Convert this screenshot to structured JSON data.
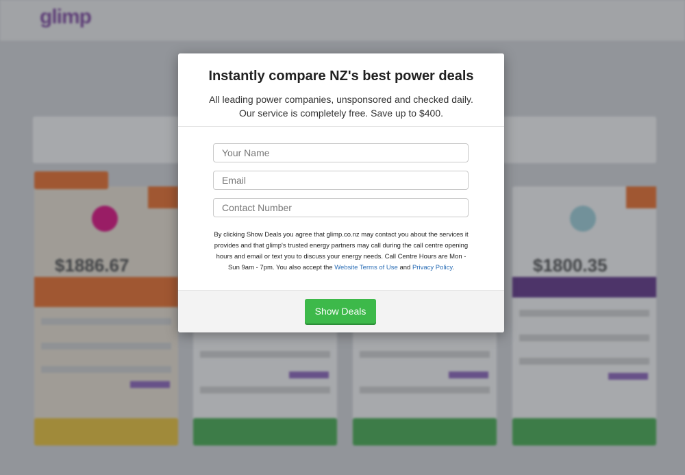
{
  "brand": {
    "logo_text": "glimp"
  },
  "modal": {
    "title": "Instantly compare NZ's best power deals",
    "line1": "All leading power companies, unsponsored and checked daily.",
    "line2": "Our service is completely free. Save up to $400.",
    "name_placeholder": "Your Name",
    "email_placeholder": "Email",
    "phone_placeholder": "Contact Number",
    "consent_text": "By clicking Show Deals you agree that glimp.co.nz may contact you about the services it provides and that glimp's trusted energy partners may call during the call centre opening hours and email or text you to discuss your energy needs. Call Centre Hours are Mon - Sun 9am - 7pm. You also accept the ",
    "terms_link": "Website Terms of Use",
    "and_text": " and ",
    "privacy_link": "Privacy Policy",
    "period": ".",
    "show_deals_label": "Show Deals"
  },
  "background_cards": [
    {
      "price": "$1886.67"
    },
    {
      "price": "$1800.35"
    }
  ],
  "colors": {
    "accent_green": "#3db94a",
    "brand_orange": "#f36b21",
    "brand_purple": "#5b2a86",
    "link_blue": "#2a6db5"
  }
}
